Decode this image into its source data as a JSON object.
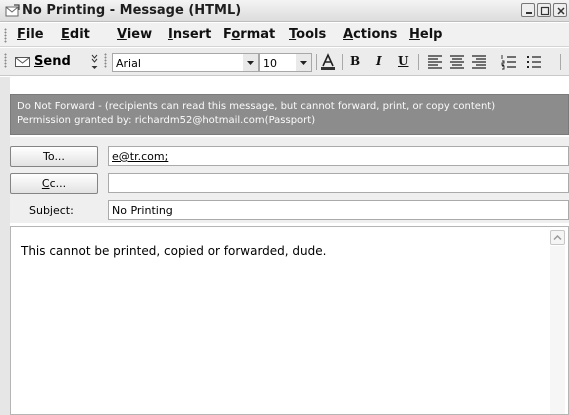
{
  "window": {
    "title": "No Printing - Message (HTML)"
  },
  "menu": {
    "items": [
      {
        "pre": "",
        "key": "F",
        "post": "ile"
      },
      {
        "pre": "",
        "key": "E",
        "post": "dit"
      },
      {
        "pre": "",
        "key": "V",
        "post": "iew"
      },
      {
        "pre": "",
        "key": "I",
        "post": "nsert"
      },
      {
        "pre": "F",
        "key": "o",
        "post": "rmat"
      },
      {
        "pre": "",
        "key": "T",
        "post": "ools"
      },
      {
        "pre": "",
        "key": "A",
        "post": "ctions"
      },
      {
        "pre": "",
        "key": "H",
        "post": "elp"
      }
    ]
  },
  "toolbar": {
    "send_pre": "",
    "send_key": "S",
    "send_post": "end",
    "font_name": "Arial",
    "font_size": "10",
    "bold_letter": "B",
    "italic_letter": "I",
    "underline_letter": "U"
  },
  "infobar": {
    "line1": "Do Not Forward - (recipients can read this message, but cannot forward, print, or copy content)",
    "line2": "Permission granted by: richardm52@hotmail.com(Passport)"
  },
  "header": {
    "to_pre": "To",
    "to_key": "",
    "to_post": "...",
    "to_value": "e@tr.com;",
    "cc_pre": "",
    "cc_key": "C",
    "cc_post": "c...",
    "cc_value": "",
    "subject_label": "Subject:",
    "subject_value": "No Printing"
  },
  "body": {
    "text": "This cannot be printed, copied or forwarded, dude."
  },
  "colors": {
    "infobar_bg": "#8c8c8c",
    "infobar_text": "#fbfbfb"
  }
}
